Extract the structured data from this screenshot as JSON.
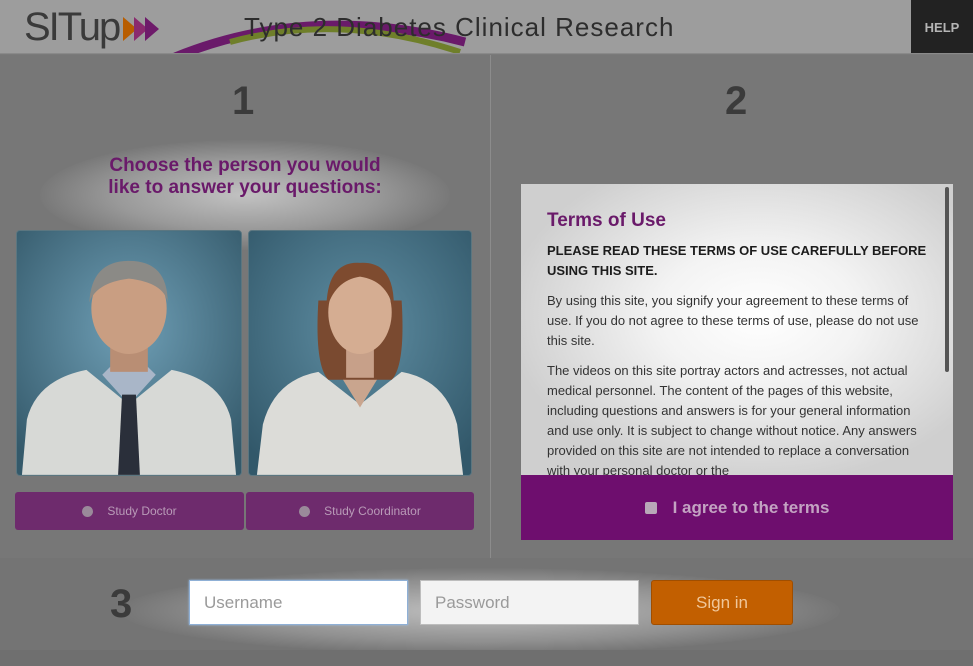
{
  "header": {
    "logo_text": "SITup",
    "title": "Type 2 Diabetes Clinical Research",
    "help_label": "HELP"
  },
  "step1": {
    "number": "1",
    "title_line1": "Choose the person you would",
    "title_line2": "like to answer your questions:",
    "options": [
      {
        "label": "Study Doctor"
      },
      {
        "label": "Study Coordinator"
      }
    ]
  },
  "step2": {
    "number": "2",
    "terms_title": "Terms of Use",
    "terms_heading": "PLEASE READ THESE TERMS OF USE CAREFULLY BEFORE USING THIS SITE.",
    "paragraphs": [
      "By using this site, you signify your agreement to these terms of use. If you do not agree to these terms of use, please do not use this site.",
      "The videos on this site portray actors and actresses, not actual medical personnel. The content of the pages of this website, including questions and answers is for your general information and use only. It is subject to change without notice. Any answers provided on this site are not intended to replace a conversation with your personal doctor or the"
    ],
    "agree_label": "I agree to the terms"
  },
  "step3": {
    "number": "3",
    "username_placeholder": "Username",
    "password_placeholder": "Password",
    "signin_label": "Sign in"
  },
  "colors": {
    "accent_purple": "#6e0e6e",
    "signin_orange": "#c25f00",
    "logo_chevrons": [
      "#c25f00",
      "#8a2a6e",
      "#6e1a6a"
    ]
  }
}
